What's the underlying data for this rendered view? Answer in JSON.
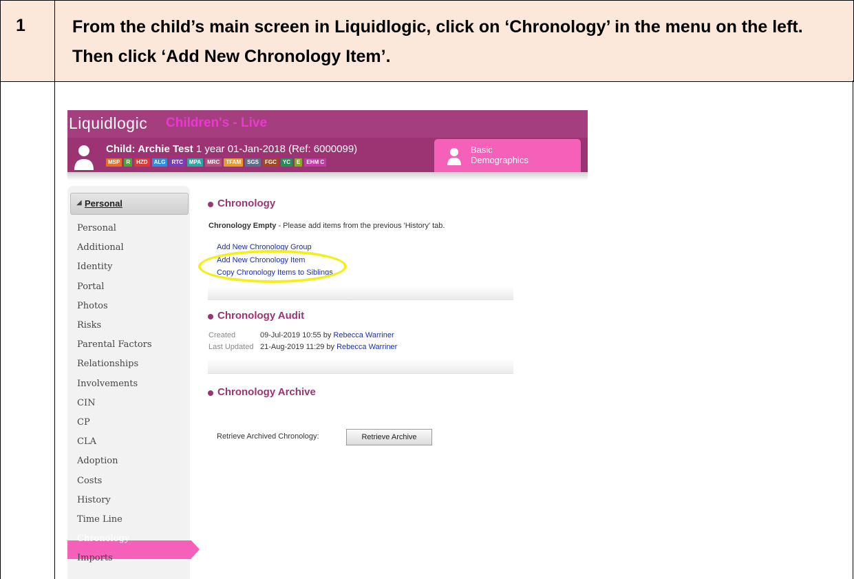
{
  "step": {
    "number": "1",
    "line1": "From the child’s main screen in Liquidlogic, click on ‘Chronology’ in the menu on the left.",
    "line2": "Then click ‘Add New Chronology Item’."
  },
  "app": {
    "brand": "Liquidlogic",
    "environment": "Children's - Live",
    "child_prefix": "Child: Archie Test",
    "child_details": " 1 year 01-Jan-2018 (Ref: 6000099)",
    "badges": [
      {
        "label": "MSP",
        "color": "#e0702a"
      },
      {
        "label": "R",
        "color": "#4aa63a"
      },
      {
        "label": "HZD",
        "color": "#d83a3a"
      },
      {
        "label": "ALG",
        "color": "#2f8ed9"
      },
      {
        "label": "RTC",
        "color": "#7a3fb8"
      },
      {
        "label": "MPA",
        "color": "#2fa6a6"
      },
      {
        "label": "MRC",
        "color": "#b0507c"
      },
      {
        "label": "TFAM",
        "color": "#e89a2a"
      },
      {
        "label": "SGS",
        "color": "#5c6e8a"
      },
      {
        "label": "FGC",
        "color": "#9c4a2a"
      },
      {
        "label": "YC",
        "color": "#2a8a5a"
      },
      {
        "label": "E",
        "color": "#8aa62a"
      },
      {
        "label": "EHM C",
        "color": "#c23aa6"
      }
    ],
    "demo_tab": {
      "line1": "Basic",
      "line2": "Demographics"
    }
  },
  "sidebar": {
    "heading": "Personal",
    "items": [
      "Personal",
      "Additional",
      "Identity",
      "Portal",
      "Photos",
      "Risks",
      "Parental Factors",
      "Relationships",
      "Involvements",
      "CIN",
      "CP",
      "CLA",
      "Adoption",
      "Costs",
      "History",
      "Time Line",
      "Chronology",
      "Imports"
    ],
    "active_index": 16
  },
  "main": {
    "chronology_title": "Chronology",
    "empty_bold": "Chronology Empty",
    "empty_text": " - Please add items from the previous 'History' tab.",
    "links": [
      "Add New Chronology Group",
      "Add New Chronology Item",
      "Copy Chronology Items to Siblings"
    ],
    "audit_title": "Chronology Audit",
    "created_label": "Created",
    "created_value": "09-Jul-2019 10:55 by ",
    "created_by": "Rebecca Warriner",
    "updated_label": "Last Updated",
    "updated_value": "21-Aug-2019 11:29 by ",
    "updated_by": "Rebecca Warriner",
    "archive_title": "Chronology Archive",
    "retrieve_label": "Retrieve Archived Chronology:",
    "retrieve_button": "Retrieve Archive"
  }
}
